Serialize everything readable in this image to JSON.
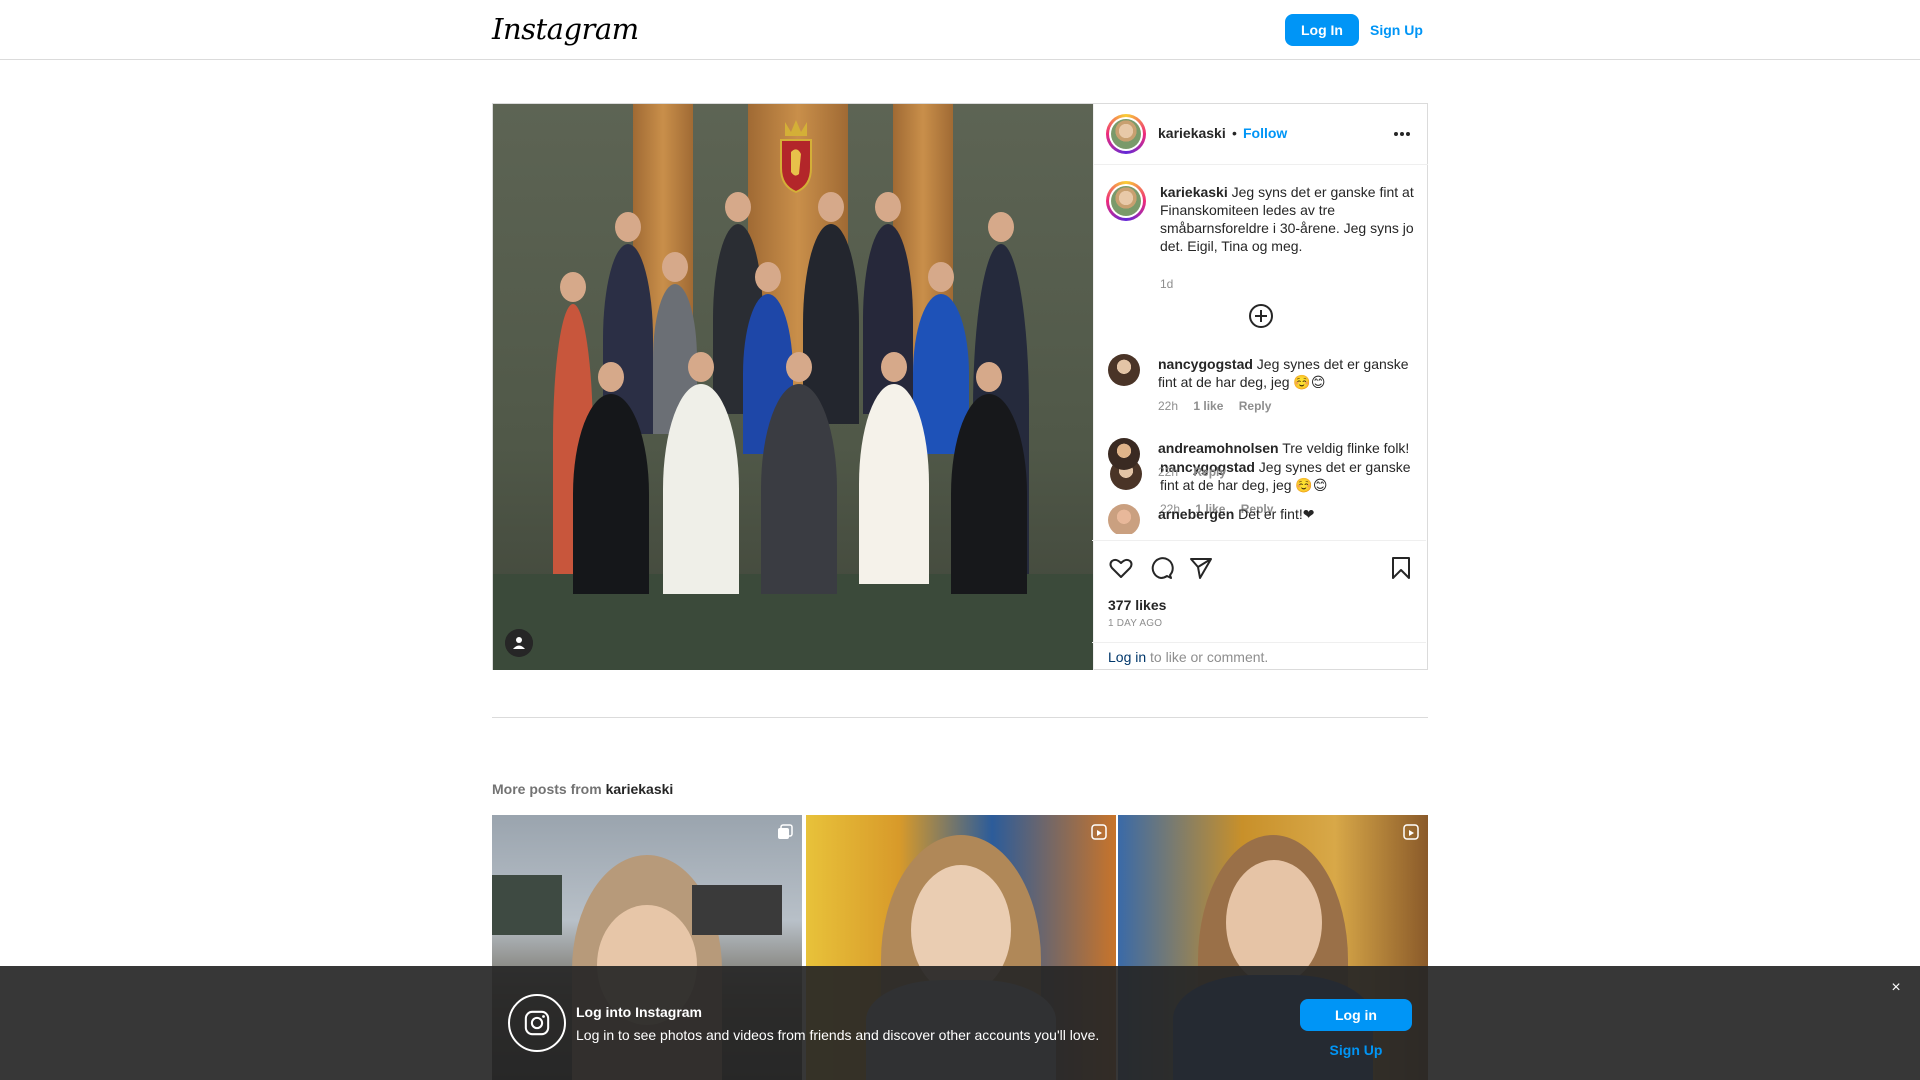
{
  "header": {
    "logo_text": "Instagram",
    "login_label": "Log In",
    "signup_label": "Sign Up"
  },
  "post": {
    "author": "kariekaski",
    "separator": "•",
    "follow_label": "Follow",
    "more_icon": "more-horizontal-icon",
    "caption": {
      "username": "kariekaski",
      "text": "Jeg syns det er ganske fint at Finanskomiteen ledes av tre småbarnsforeldre i 30-årene. Jeg syns jo det. Eigil, Tina og meg.",
      "time": "1d"
    },
    "load_more_icon": "plus-circle-icon",
    "comments": [
      {
        "username": "nancygogstad",
        "text": "Jeg synes det er ganske fint at de har deg, jeg ☺️😊",
        "time": "22h",
        "likes": "1 like",
        "reply": "Reply"
      },
      {
        "username": "andreamohnolsen",
        "text": "Tre veldig flinke folk!",
        "time": "22h",
        "reply": "Reply"
      },
      {
        "username": "arnebergen",
        "text": "Det er fint!❤",
        "time": "",
        "reply": ""
      }
    ],
    "likes": "377 likes",
    "posted_ago": "1 DAY AGO",
    "login_link": "Log in",
    "login_suffix": " to like or comment."
  },
  "more_posts": {
    "prefix": "More posts from ",
    "username": "kariekaski"
  },
  "banner": {
    "title": "Log into Instagram",
    "text": "Log in to see photos and videos from friends and discover other accounts you'll love.",
    "login_label": "Log in",
    "signup_label": "Sign Up",
    "close_label": "×"
  },
  "colors": {
    "accent": "#0095f6",
    "border": "#dbdbdb",
    "banner_bg": "#262626"
  }
}
